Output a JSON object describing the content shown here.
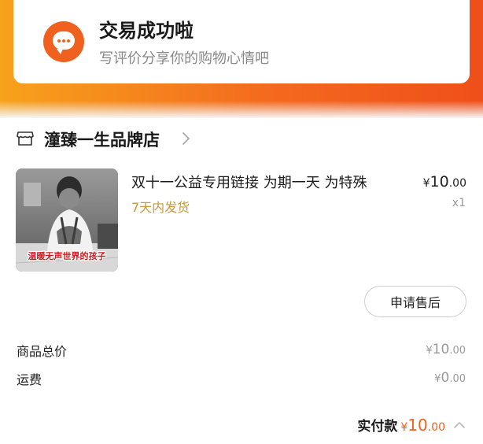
{
  "status": {
    "title": "交易成功啦",
    "subtitle": "写评价分享你的购物心情吧",
    "icon": "chat-bubble-icon"
  },
  "shop": {
    "name": "潼臻一生品牌店",
    "icon": "store-icon"
  },
  "product": {
    "title": "双十一公益专用链接 为期一天 为特殊",
    "shipping_note": "7天内发货",
    "price_symbol": "¥",
    "price_main": "10",
    "price_cents": ".00",
    "quantity": "x1",
    "image_caption": "温暖无声世界的孩子"
  },
  "actions": {
    "after_sale_label": "申请售后"
  },
  "summary": {
    "goods_total_label": "商品总价",
    "goods_total_symbol": "¥",
    "goods_total_main": "10",
    "goods_total_cents": ".00",
    "shipping_label": "运费",
    "shipping_symbol": "¥",
    "shipping_main": "0",
    "shipping_cents": ".00",
    "paid_label": "实付款",
    "paid_symbol": "¥",
    "paid_main": "10",
    "paid_cents": ".00"
  },
  "colors": {
    "accent": "#f0611f",
    "banner_start": "#f7a21b",
    "banner_end": "#ef4f1a",
    "shipping_note": "#c8963b"
  }
}
